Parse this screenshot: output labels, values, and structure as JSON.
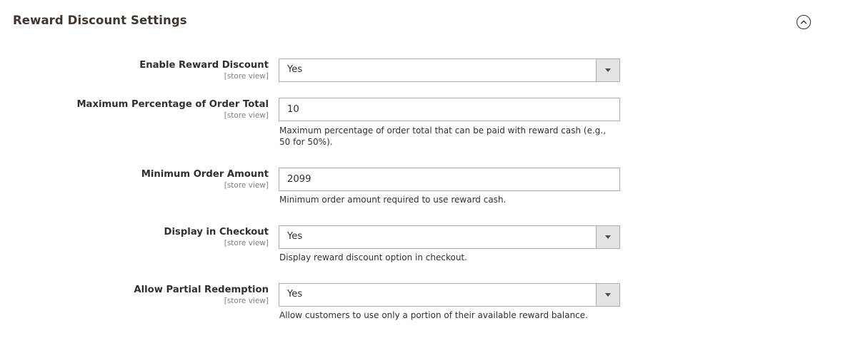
{
  "section": {
    "title": "Reward Discount Settings",
    "collapse_icon": "chevron-up-circle-icon"
  },
  "fields": {
    "enable": {
      "label": "Enable Reward Discount",
      "scope": "[store view]",
      "value": "Yes"
    },
    "max_percentage": {
      "label": "Maximum Percentage of Order Total",
      "scope": "[store view]",
      "value": "10",
      "note": "Maximum percentage of order total that can be paid with reward cash (e.g., 50 for 50%)."
    },
    "min_order": {
      "label": "Minimum Order Amount",
      "scope": "[store view]",
      "value": "2099",
      "note": "Minimum order amount required to use reward cash."
    },
    "display_checkout": {
      "label": "Display in Checkout",
      "scope": "[store view]",
      "value": "Yes",
      "note": "Display reward discount option in checkout."
    },
    "partial_redemption": {
      "label": "Allow Partial Redemption",
      "scope": "[store view]",
      "value": "Yes",
      "note": "Allow customers to use only a portion of their available reward balance."
    }
  },
  "colors": {
    "title": "#41362f",
    "text": "#303030",
    "scope": "#808080",
    "border": "#adadad",
    "select_button_bg": "#e3e3e3"
  }
}
